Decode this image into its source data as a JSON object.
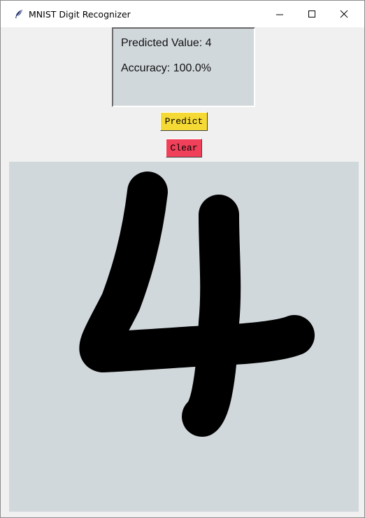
{
  "window": {
    "title": "MNIST Digit Recognizer",
    "controls": [
      "minimize-icon",
      "maximize-icon",
      "close-icon"
    ]
  },
  "result": {
    "predicted_text": "Predicted Value: 4",
    "accuracy_text": "Accuracy: 100.0%"
  },
  "buttons": {
    "predict_label": "Predict",
    "predict_color": "#f5da36",
    "clear_label": "Clear",
    "clear_color": "#f0405a"
  },
  "canvas": {
    "background_color": "#d1d8dc",
    "stroke_color": "#000000",
    "drawn_content": "handwritten digit sketch"
  }
}
